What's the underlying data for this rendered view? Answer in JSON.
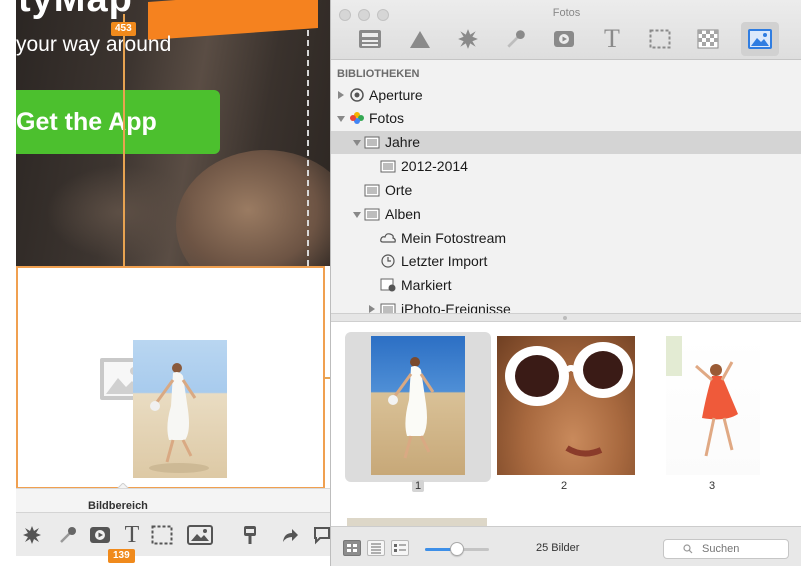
{
  "canvas": {
    "hero_title": "tyMap",
    "tagline": "your way around",
    "cta_label": "Get the App",
    "guide_badge_top": "453",
    "guide_badge_bottom": "139",
    "panel_label": "Bildbereich",
    "tools": [
      "burst-icon",
      "brush-icon",
      "video-icon",
      "text-icon",
      "selection-icon",
      "image-icon",
      "pin-icon",
      "share-icon"
    ]
  },
  "browser": {
    "title": "Fotos",
    "toolbar": [
      "layout-icon",
      "shape-icon",
      "burst-icon",
      "brush-icon",
      "video-icon",
      "text-icon",
      "selection-icon",
      "texture-icon",
      "photos-icon"
    ],
    "active_tool": "photos-icon",
    "section_header": "BIBLIOTHEKEN",
    "tree": [
      {
        "label": "Aperture",
        "icon": "aperture-icon",
        "state": "collapsed"
      },
      {
        "label": "Fotos",
        "icon": "photos-app-icon",
        "state": "expanded"
      },
      {
        "label": "Jahre",
        "icon": "folder-icon",
        "state": "expanded",
        "selected": true
      },
      {
        "label": "2012-2014",
        "icon": "folder-icon"
      },
      {
        "label": "Orte",
        "icon": "folder-icon"
      },
      {
        "label": "Alben",
        "icon": "folder-icon",
        "state": "expanded"
      },
      {
        "label": "Mein Fotostream",
        "icon": "cloud-icon"
      },
      {
        "label": "Letzter Import",
        "icon": "clock-icon"
      },
      {
        "label": "Markiert",
        "icon": "flag-icon"
      },
      {
        "label": "iPhoto-Ereignisse",
        "icon": "folder-icon",
        "state": "collapsed"
      }
    ],
    "photos": [
      {
        "caption": "1",
        "selected": true
      },
      {
        "caption": "2"
      },
      {
        "caption": "3"
      }
    ],
    "status": {
      "count": "25 Bilder",
      "search_placeholder": "Suchen",
      "view_modes": [
        "grid-view-icon",
        "list-view-icon",
        "detail-view-icon"
      ],
      "active_view": "grid-view-icon",
      "thumbnail_size": 0.5
    }
  }
}
